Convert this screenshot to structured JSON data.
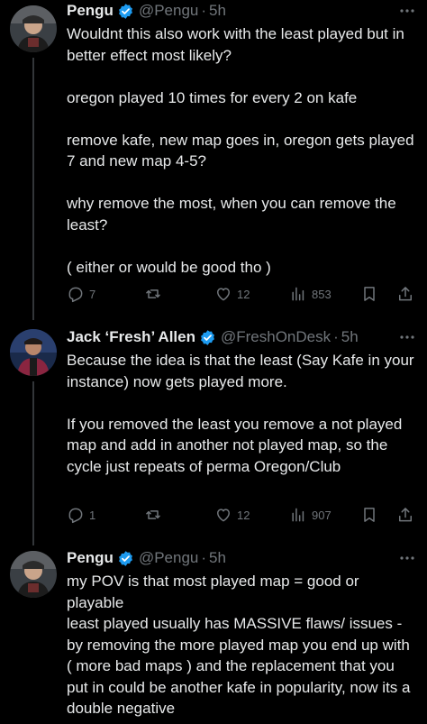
{
  "tweets": [
    {
      "author": "Pengu",
      "handle": "@Pengu",
      "time": "5h",
      "paragraphs": [
        "Wouldnt this also work with the least played but in better effect most likely?",
        "oregon played 10 times for every 2 on kafe",
        "remove kafe, new map goes in, oregon gets played 7 and new map 4-5?",
        "why remove the most, when you can remove the least?",
        "( either or would be good tho )"
      ],
      "replies": "7",
      "likes": "12",
      "views": "853"
    },
    {
      "author": "Jack ‘Fresh’ Allen",
      "handle": "@FreshOnDesk",
      "time": "5h",
      "paragraphs": [
        "Because the idea is that the least (Say Kafe in your instance) now gets played more.",
        "If you removed the least you remove a not played map and add in another not played map, so the cycle just repeats of perma Oregon/Club"
      ],
      "replies": "1",
      "likes": "12",
      "views": "907"
    },
    {
      "author": "Pengu",
      "handle": "@Pengu",
      "time": "5h",
      "paragraphs": [
        "my POV is that most played map = good or playable",
        "least played usually has MASSIVE flaws/ issues - by removing the more played map you end up with ( more bad maps ) and the replacement that you put in could be another kafe in popularity, now its a double negative"
      ]
    }
  ],
  "separator": "·",
  "colors": {
    "background": "#000000",
    "text": "#e7e9ea",
    "muted": "#71767b",
    "verified": "#1d9bf0"
  },
  "icons": {
    "reply": "reply-icon",
    "retweet": "retweet-icon",
    "like": "heart-icon",
    "views": "views-bar-chart-icon",
    "bookmark": "bookmark-icon",
    "share": "share-icon",
    "verified": "verified-badge-icon",
    "more": "more-options-icon"
  }
}
